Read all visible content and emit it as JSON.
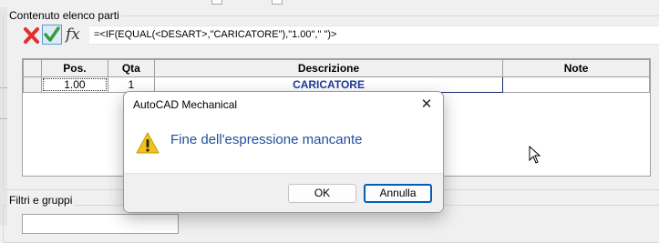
{
  "group_parts": {
    "label": "Contenuto elenco parti"
  },
  "formula_bar": {
    "cancel_icon": "red-x-icon",
    "accept_icon": "green-check-icon",
    "fx_glyph": "fx",
    "expression": "=<IF(EQUAL(<DESART>,\"CARICATORE\"),\"1.00\",\" \")>"
  },
  "table": {
    "columns": [
      "",
      "Pos.",
      "Qta",
      "Descrizione",
      "Note"
    ],
    "rows": [
      {
        "pos": "1.00",
        "qta": "1",
        "descrizione": "CARICATORE",
        "note": ""
      }
    ]
  },
  "group_filters": {
    "label": "Filtri e gruppi"
  },
  "dialog": {
    "title": "AutoCAD Mechanical",
    "close_glyph": "✕",
    "icon": "warning-icon",
    "message": "Fine dell'espressione mancante",
    "ok_label": "OK",
    "cancel_label": "Annulla"
  },
  "colors": {
    "accent": "#005fb8",
    "message_text": "#1f4e9c",
    "description_text": "#1f3c9a",
    "warning": "#f2c21b"
  }
}
